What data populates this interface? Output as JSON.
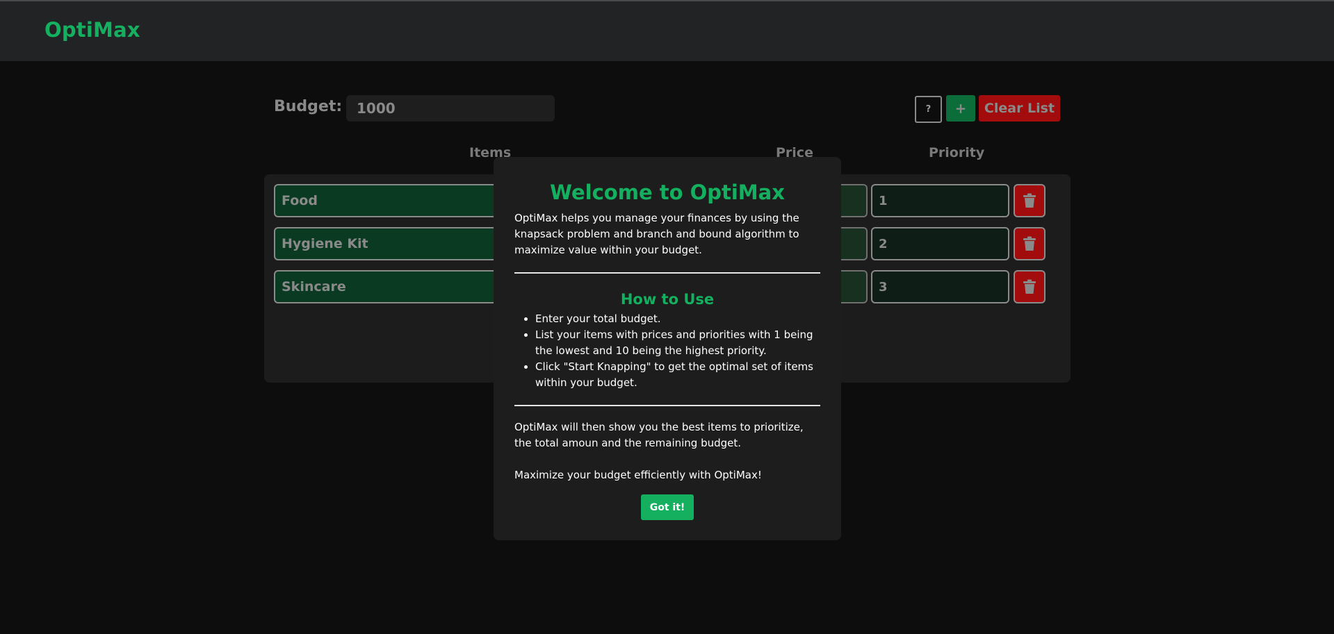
{
  "app": {
    "logo": "OptiMax"
  },
  "budget": {
    "label": "Budget:",
    "value": "1000"
  },
  "toolbar": {
    "help_label": "?",
    "add_label": "+",
    "clear_label": "Clear List"
  },
  "columns": {
    "items": "Items",
    "price": "Price",
    "priority": "Priority"
  },
  "rows": [
    {
      "item": "Food",
      "priority": "1"
    },
    {
      "item": "Hygiene Kit",
      "priority": "2"
    },
    {
      "item": "Skincare",
      "priority": "3"
    }
  ],
  "modal": {
    "title": "Welcome to OptiMax",
    "intro": "OptiMax helps you manage your finances by using the knapsack problem and branch and bound algorithm to maximize value within your budget.",
    "how_title": "How to Use",
    "steps": [
      "Enter your total budget.",
      "List your items with prices and priorities with 1 being the lowest and 10 being the highest priority.",
      "Click \"Start Knapping\" to get the optimal set of items within your budget."
    ],
    "outro": "OptiMax will then show you the best items to prioritize, the total amoun and the remaining budget.",
    "closing": "Maximize your budget efficiently with OptiMax!",
    "button": "Got it!"
  },
  "icons": {
    "delete": "trash-icon"
  },
  "colors": {
    "accent": "#14b060",
    "danger": "#a30c0c",
    "add": "#0b6e3a"
  }
}
